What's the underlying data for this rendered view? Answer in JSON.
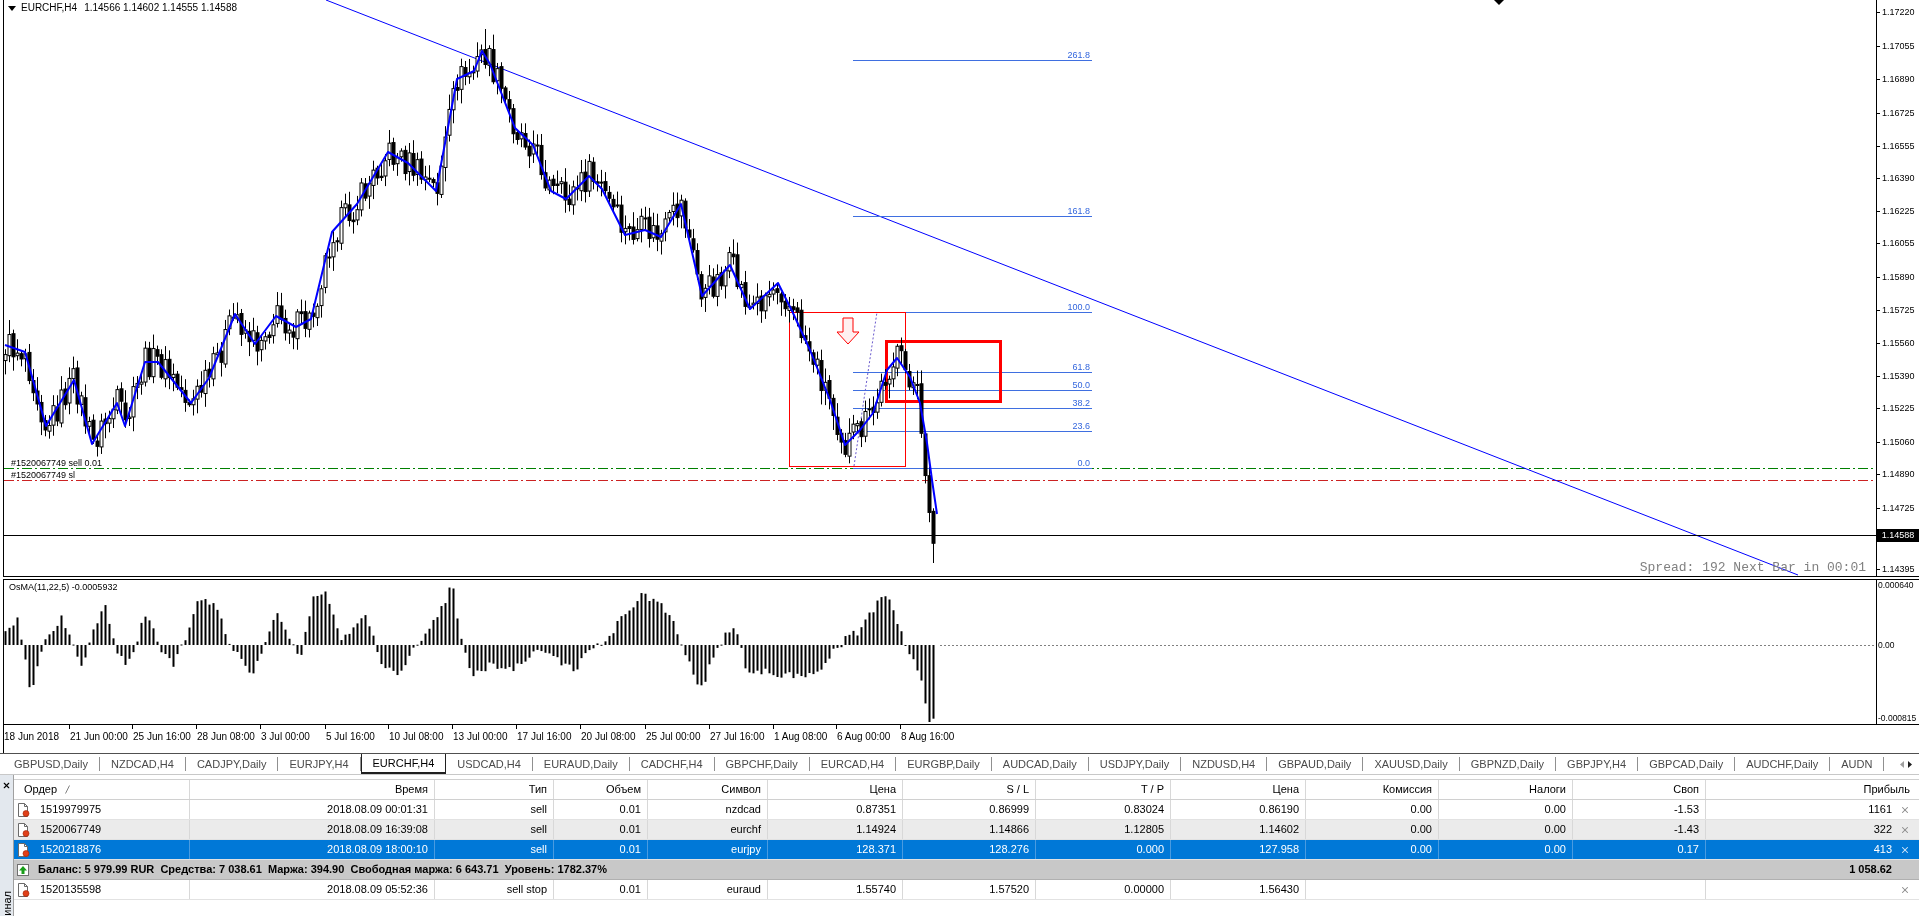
{
  "chart": {
    "symbol": "EURCHF,H4",
    "quote": "1.14566 1.14602 1.14555 1.14588",
    "fib_levels": [
      "261.8",
      "161.8",
      "100.0",
      "61.8",
      "50.0",
      "38.2",
      "23.6",
      "0.0"
    ],
    "order_lines": [
      {
        "label": "#1520067749 sell 0.01",
        "color": "#008000"
      },
      {
        "label": "#1520067749 sl",
        "color": "#cc2222"
      }
    ],
    "info_text": "Spread: 192 Next Bar in 00:01",
    "price_axis": [
      "1.17220",
      "1.17055",
      "1.16890",
      "1.16725",
      "1.16555",
      "1.16390",
      "1.16225",
      "1.16055",
      "1.15890",
      "1.15725",
      "1.15560",
      "1.15390",
      "1.15225",
      "1.15060",
      "1.14890",
      "1.14725",
      "1.14395"
    ],
    "current_price": "1.14588"
  },
  "indicator": {
    "label": "OsMA(11,22,5) -0.0005932",
    "axis": [
      "0.000640",
      "0.00",
      "-0.000815"
    ]
  },
  "time_axis": [
    "18 Jun 2018",
    "21 Jun 00:00",
    "25 Jun 16:00",
    "28 Jun 08:00",
    "3 Jul 00:00",
    "5 Jul 16:00",
    "10 Jul 08:00",
    "13 Jul 00:00",
    "17 Jul 16:00",
    "20 Jul 08:00",
    "25 Jul 00:00",
    "27 Jul 16:00",
    "1 Aug 08:00",
    "6 Aug 00:00",
    "8 Aug 16:00"
  ],
  "tabs": [
    {
      "label": "GBPUSD,Daily",
      "selected": false
    },
    {
      "label": "NZDCAD,H4",
      "selected": false
    },
    {
      "label": "CADJPY,Daily",
      "selected": false
    },
    {
      "label": "EURJPY,H4",
      "selected": false
    },
    {
      "label": "EURCHF,H4",
      "selected": true
    },
    {
      "label": "USDCAD,H4",
      "selected": false
    },
    {
      "label": "EURAUD,Daily",
      "selected": false
    },
    {
      "label": "CADCHF,H4",
      "selected": false
    },
    {
      "label": "GBPCHF,Daily",
      "selected": false
    },
    {
      "label": "EURCAD,H4",
      "selected": false
    },
    {
      "label": "EURGBP,Daily",
      "selected": false
    },
    {
      "label": "AUDCAD,Daily",
      "selected": false
    },
    {
      "label": "USDJPY,Daily",
      "selected": false
    },
    {
      "label": "NZDUSD,H4",
      "selected": false
    },
    {
      "label": "GBPAUD,Daily",
      "selected": false
    },
    {
      "label": "XAUUSD,Daily",
      "selected": false
    },
    {
      "label": "GBPNZD,Daily",
      "selected": false
    },
    {
      "label": "GBPJPY,H4",
      "selected": false
    },
    {
      "label": "GBPCAD,Daily",
      "selected": false
    },
    {
      "label": "AUDCHF,Daily",
      "selected": false
    },
    {
      "label": "AUDN",
      "selected": false
    }
  ],
  "terminal": {
    "side_label": "инал",
    "columns": [
      "Ордер",
      "Время",
      "Тип",
      "Объем",
      "Символ",
      "Цена",
      "S / L",
      "T / P",
      "Цена",
      "Комиссия",
      "Налоги",
      "Своп",
      "Прибыль"
    ],
    "orders": [
      {
        "cells": [
          "1519979975",
          "2018.08.09 00:01:31",
          "sell",
          "0.01",
          "nzdcad",
          "0.87351",
          "0.86999",
          "0.83024",
          "0.86190",
          "0.00",
          "0.00",
          "-1.53",
          "1161"
        ],
        "selected": false
      },
      {
        "cells": [
          "1520067749",
          "2018.08.09 16:39:08",
          "sell",
          "0.01",
          "eurchf",
          "1.14924",
          "1.14866",
          "1.12805",
          "1.14602",
          "0.00",
          "0.00",
          "-1.43",
          "322"
        ],
        "selected": false
      },
      {
        "cells": [
          "1520218876",
          "2018.08.09 18:00:10",
          "sell",
          "0.01",
          "eurjpy",
          "128.371",
          "128.276",
          "0.000",
          "127.958",
          "0.00",
          "0.00",
          "0.17",
          "413"
        ],
        "selected": true
      }
    ],
    "balance": {
      "summary": "Баланс: 5 979.99 RUR  Средства: 7 038.61  Маржа: 394.90  Свободная маржа: 6 643.71  Уровень: 1782.37%",
      "profit": "1 058.62"
    },
    "pending_orders": [
      {
        "cells": [
          "1520135598",
          "2018.08.09 05:52:36",
          "sell stop",
          "0.01",
          "euraud",
          "1.55740",
          "1.57520",
          "0.00000",
          "1.56430"
        ],
        "selected": false
      }
    ]
  }
}
